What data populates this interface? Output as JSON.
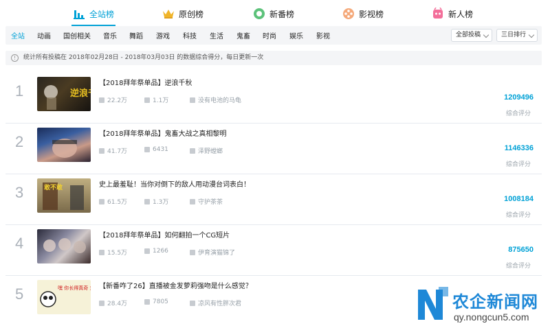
{
  "top_tabs": [
    {
      "label": "全站榜",
      "icon": "bar-chart-icon",
      "active": true
    },
    {
      "label": "原创榜",
      "icon": "crown-icon",
      "active": false
    },
    {
      "label": "新番榜",
      "icon": "ring-icon",
      "active": false
    },
    {
      "label": "影视榜",
      "icon": "film-reel-icon",
      "active": false
    },
    {
      "label": "新人榜",
      "icon": "mascot-icon",
      "active": false
    }
  ],
  "categories": [
    "全站",
    "动画",
    "国创相关",
    "音乐",
    "舞蹈",
    "游戏",
    "科技",
    "生活",
    "鬼畜",
    "时尚",
    "娱乐",
    "影视"
  ],
  "filters": {
    "type": "全部投稿",
    "period": "三日排行"
  },
  "notice": "统计所有投稿在 2018年02月28日 - 2018年03月03日 的数据综合得分，每日更新一次",
  "score_label": "综合评分",
  "rows": [
    {
      "rank": "1",
      "title": "【2018拜年祭单品】逆浪千秋",
      "plays": "22.2万",
      "danmaku": "1.1万",
      "uploader": "没有电池的马龟",
      "score": "1209496"
    },
    {
      "rank": "2",
      "title": "【2018拜年祭单品】鬼畜大战之真相黎明",
      "plays": "41.7万",
      "danmaku": "6431",
      "uploader": "泽野螳螂",
      "score": "1146336"
    },
    {
      "rank": "3",
      "title": "史上最羞耻！当你对倒下的敌人用动漫台词表白！",
      "plays": "61.5万",
      "danmaku": "1.3万",
      "uploader": "守护茶茶",
      "score": "1008184"
    },
    {
      "rank": "4",
      "title": "【2018拜年祭单品】如何翻拍一个CG短片",
      "plays": "15.5万",
      "danmaku": "1266",
      "uploader": "伊育演猫锦了",
      "score": "875650"
    },
    {
      "rank": "5",
      "title": "【新番咋了26】直播被金发萝莉强吻是什么感觉？",
      "plays": "28.4万",
      "danmaku": "7805",
      "uploader": "凉风有性胖次君",
      "score": ""
    }
  ],
  "thumb_texts": {
    "t1": "逆浪千秋",
    "t3": "敢不敢",
    "t5": "嘿 你长得真奇 对!说是你个 家伙!"
  },
  "watermark": {
    "text": "农企新闻网",
    "url": "qy.nongcun5.com"
  },
  "colors": {
    "accent": "#00a1d6",
    "rank_gray": "#aab0b8"
  }
}
